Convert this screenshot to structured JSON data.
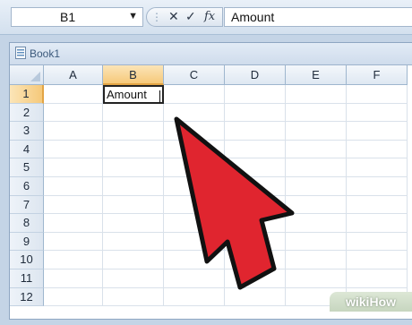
{
  "formula_bar": {
    "name_box": "B1",
    "formula_text": "Amount",
    "icons": [
      "dot-icon",
      "cancel-icon",
      "enter-icon",
      "fx-icon"
    ]
  },
  "workbook": {
    "title": "Book1",
    "columns": [
      "A",
      "B",
      "C",
      "D",
      "E",
      "F"
    ],
    "rows": [
      "1",
      "2",
      "3",
      "4",
      "5",
      "6",
      "7",
      "8",
      "9",
      "10",
      "11",
      "12"
    ],
    "selected_cell": "B1",
    "cell_B1": "Amount"
  },
  "watermark": {
    "wiki": "wiki",
    "how": "How"
  },
  "colors": {
    "cursor": "#e0252f",
    "cursor_outline": "#111111",
    "header_selected": "#f6c97a"
  }
}
